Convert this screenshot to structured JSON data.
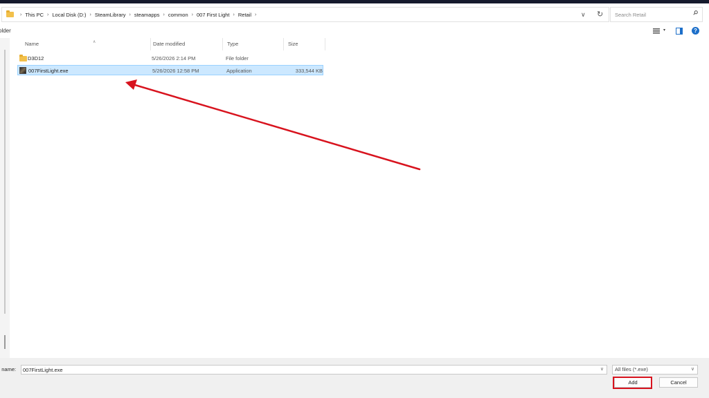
{
  "breadcrumb": {
    "items": [
      "This PC",
      "Local Disk (D:)",
      "SteamLibrary",
      "steamapps",
      "common",
      "007 First Light",
      "Retail"
    ]
  },
  "search": {
    "placeholder": "Search Retail"
  },
  "toolbar": {
    "folder_label": "older"
  },
  "columns": {
    "name": "Name",
    "date": "Date modified",
    "type": "Type",
    "size": "Size"
  },
  "files": [
    {
      "name": "D3D12",
      "date": "5/26/2026 2:14 PM",
      "type": "File folder",
      "size": "",
      "icon": "folder-icon"
    },
    {
      "name": "007FirstLight.exe",
      "date": "5/26/2026 12:58 PM",
      "type": "Application",
      "size": "333,544 KB",
      "icon": "exe-icon",
      "selected": true
    }
  ],
  "footer": {
    "filename_label": "e name:",
    "filename_value": "007FirstLight.exe",
    "filetype_value": "All files (*.exe)",
    "add_label": "Add",
    "cancel_label": "Cancel"
  },
  "colors": {
    "accent": "#1d6fc9",
    "annotation": "#d8131e",
    "selection": "#cce8ff"
  }
}
